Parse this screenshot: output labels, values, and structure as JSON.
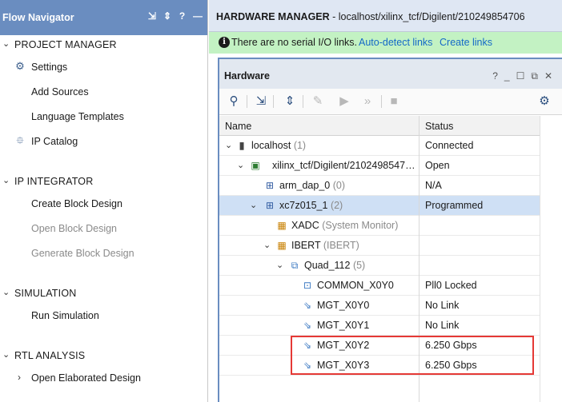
{
  "flow_navigator": {
    "title": "Flow Navigator",
    "tools": [
      "⇲",
      "⇕",
      "?",
      "—"
    ],
    "sections": [
      {
        "label": "PROJECT MANAGER",
        "items": [
          {
            "label": "Settings",
            "icon": "gear-icon",
            "enabled": true
          },
          {
            "label": "Add Sources",
            "enabled": true
          },
          {
            "label": "Language Templates",
            "enabled": true
          },
          {
            "label": "IP Catalog",
            "icon": "ip-catalog-icon",
            "enabled": true
          }
        ]
      },
      {
        "label": "IP INTEGRATOR",
        "items": [
          {
            "label": "Create Block Design",
            "enabled": true
          },
          {
            "label": "Open Block Design",
            "enabled": false
          },
          {
            "label": "Generate Block Design",
            "enabled": false
          }
        ]
      },
      {
        "label": "SIMULATION",
        "items": [
          {
            "label": "Run Simulation",
            "enabled": true
          }
        ]
      },
      {
        "label": "RTL ANALYSIS",
        "items": [
          {
            "label": "Open Elaborated Design",
            "enabled": true
          }
        ]
      }
    ]
  },
  "hardware_manager": {
    "title_bold": "HARDWARE MANAGER",
    "title_rest": " - localhost/xilinx_tcf/Digilent/210249854706",
    "banner": {
      "message": "There are no serial I/O links.",
      "auto_detect": "Auto-detect links",
      "create": "Create links"
    },
    "panel": {
      "title": "Hardware",
      "window_buttons": [
        "?",
        "_",
        "☐",
        "⧉",
        "✕"
      ],
      "columns": {
        "name": "Name",
        "status": "Status"
      },
      "rows": [
        {
          "name": "localhost",
          "suffix": " (1)",
          "status": "Connected",
          "icon": "host-icon"
        },
        {
          "name": "xilinx_tcf/Digilent/2102498547…",
          "suffix": "",
          "status": "Open",
          "icon": "board-icon"
        },
        {
          "name": "arm_dap_0",
          "suffix": " (0)",
          "status": "N/A",
          "icon": "chip-icon"
        },
        {
          "name": "xc7z015_1",
          "suffix": " (2)",
          "status": "Programmed",
          "icon": "chip-icon"
        },
        {
          "name": "XADC",
          "suffix": " (System Monitor)",
          "status": "",
          "icon": "core-icon"
        },
        {
          "name": "IBERT",
          "suffix": " (IBERT)",
          "status": "",
          "icon": "core-icon"
        },
        {
          "name": "Quad_112",
          "suffix": " (5)",
          "status": "",
          "icon": "quad-icon"
        },
        {
          "name": "COMMON_X0Y0",
          "suffix": "",
          "status": "Pll0 Locked",
          "icon": "common-icon"
        },
        {
          "name": "MGT_X0Y0",
          "suffix": "",
          "status": "No Link",
          "icon": "mgt-icon"
        },
        {
          "name": "MGT_X0Y1",
          "suffix": "",
          "status": "No Link",
          "icon": "mgt-icon"
        },
        {
          "name": "MGT_X0Y2",
          "suffix": "",
          "status": "6.250 Gbps",
          "icon": "mgt-icon"
        },
        {
          "name": "MGT_X0Y3",
          "suffix": "",
          "status": "6.250 Gbps",
          "icon": "mgt-icon"
        }
      ]
    }
  },
  "colors": {
    "nav_header": "#6a8dc0",
    "banner_bg": "#c3f2c3",
    "link": "#1469c8",
    "selected_row": "#cfe0f5",
    "highlight": "#e53935"
  }
}
